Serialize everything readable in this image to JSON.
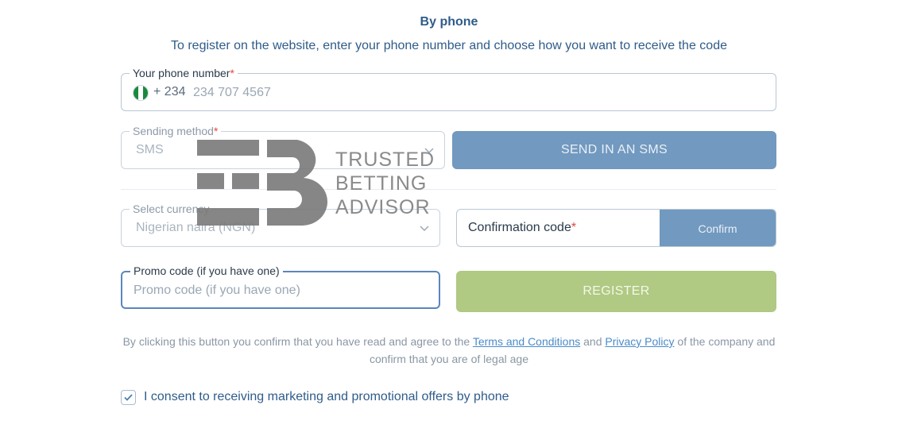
{
  "header": {
    "title": "By phone",
    "subtitle": "To register on the website, enter your phone number and choose how you want to receive the code"
  },
  "phone": {
    "label": "Your phone number",
    "required_mark": "*",
    "dial_code": "+ 234",
    "placeholder": "234 707 4567",
    "flag_icon": "nigeria-flag-icon"
  },
  "sending_method": {
    "label": "Sending method",
    "required_mark": "*",
    "value": "SMS"
  },
  "send_button": {
    "label": "SEND IN AN SMS"
  },
  "currency": {
    "label": "Select currency",
    "value": "Nigerian naira (NGN)"
  },
  "confirmation": {
    "label": "Confirmation code",
    "required_mark": "*",
    "button_label": "Confirm"
  },
  "promo": {
    "label": "Promo code (if you have one)",
    "placeholder": "Promo code (if you have one)"
  },
  "register_button": {
    "label": "REGISTER"
  },
  "legal": {
    "text_before": "By clicking this button you confirm that you have read and agree to the ",
    "terms_link": "Terms and Conditions",
    "text_and": " and ",
    "privacy_link": "Privacy Policy",
    "text_after": " of the company and confirm that you are of legal age"
  },
  "consent": {
    "checked": true,
    "label": "I consent to receiving marketing and promotional offers by phone"
  },
  "watermark": {
    "line1": "TRUSTED",
    "line2": "BETTING",
    "line3": "ADVISOR"
  },
  "colors": {
    "accent_blue": "#7299bf",
    "register_green": "#b0c983",
    "title_blue": "#2f5c8a",
    "required_red": "#e2483d",
    "link_blue": "#4a8bc9"
  }
}
